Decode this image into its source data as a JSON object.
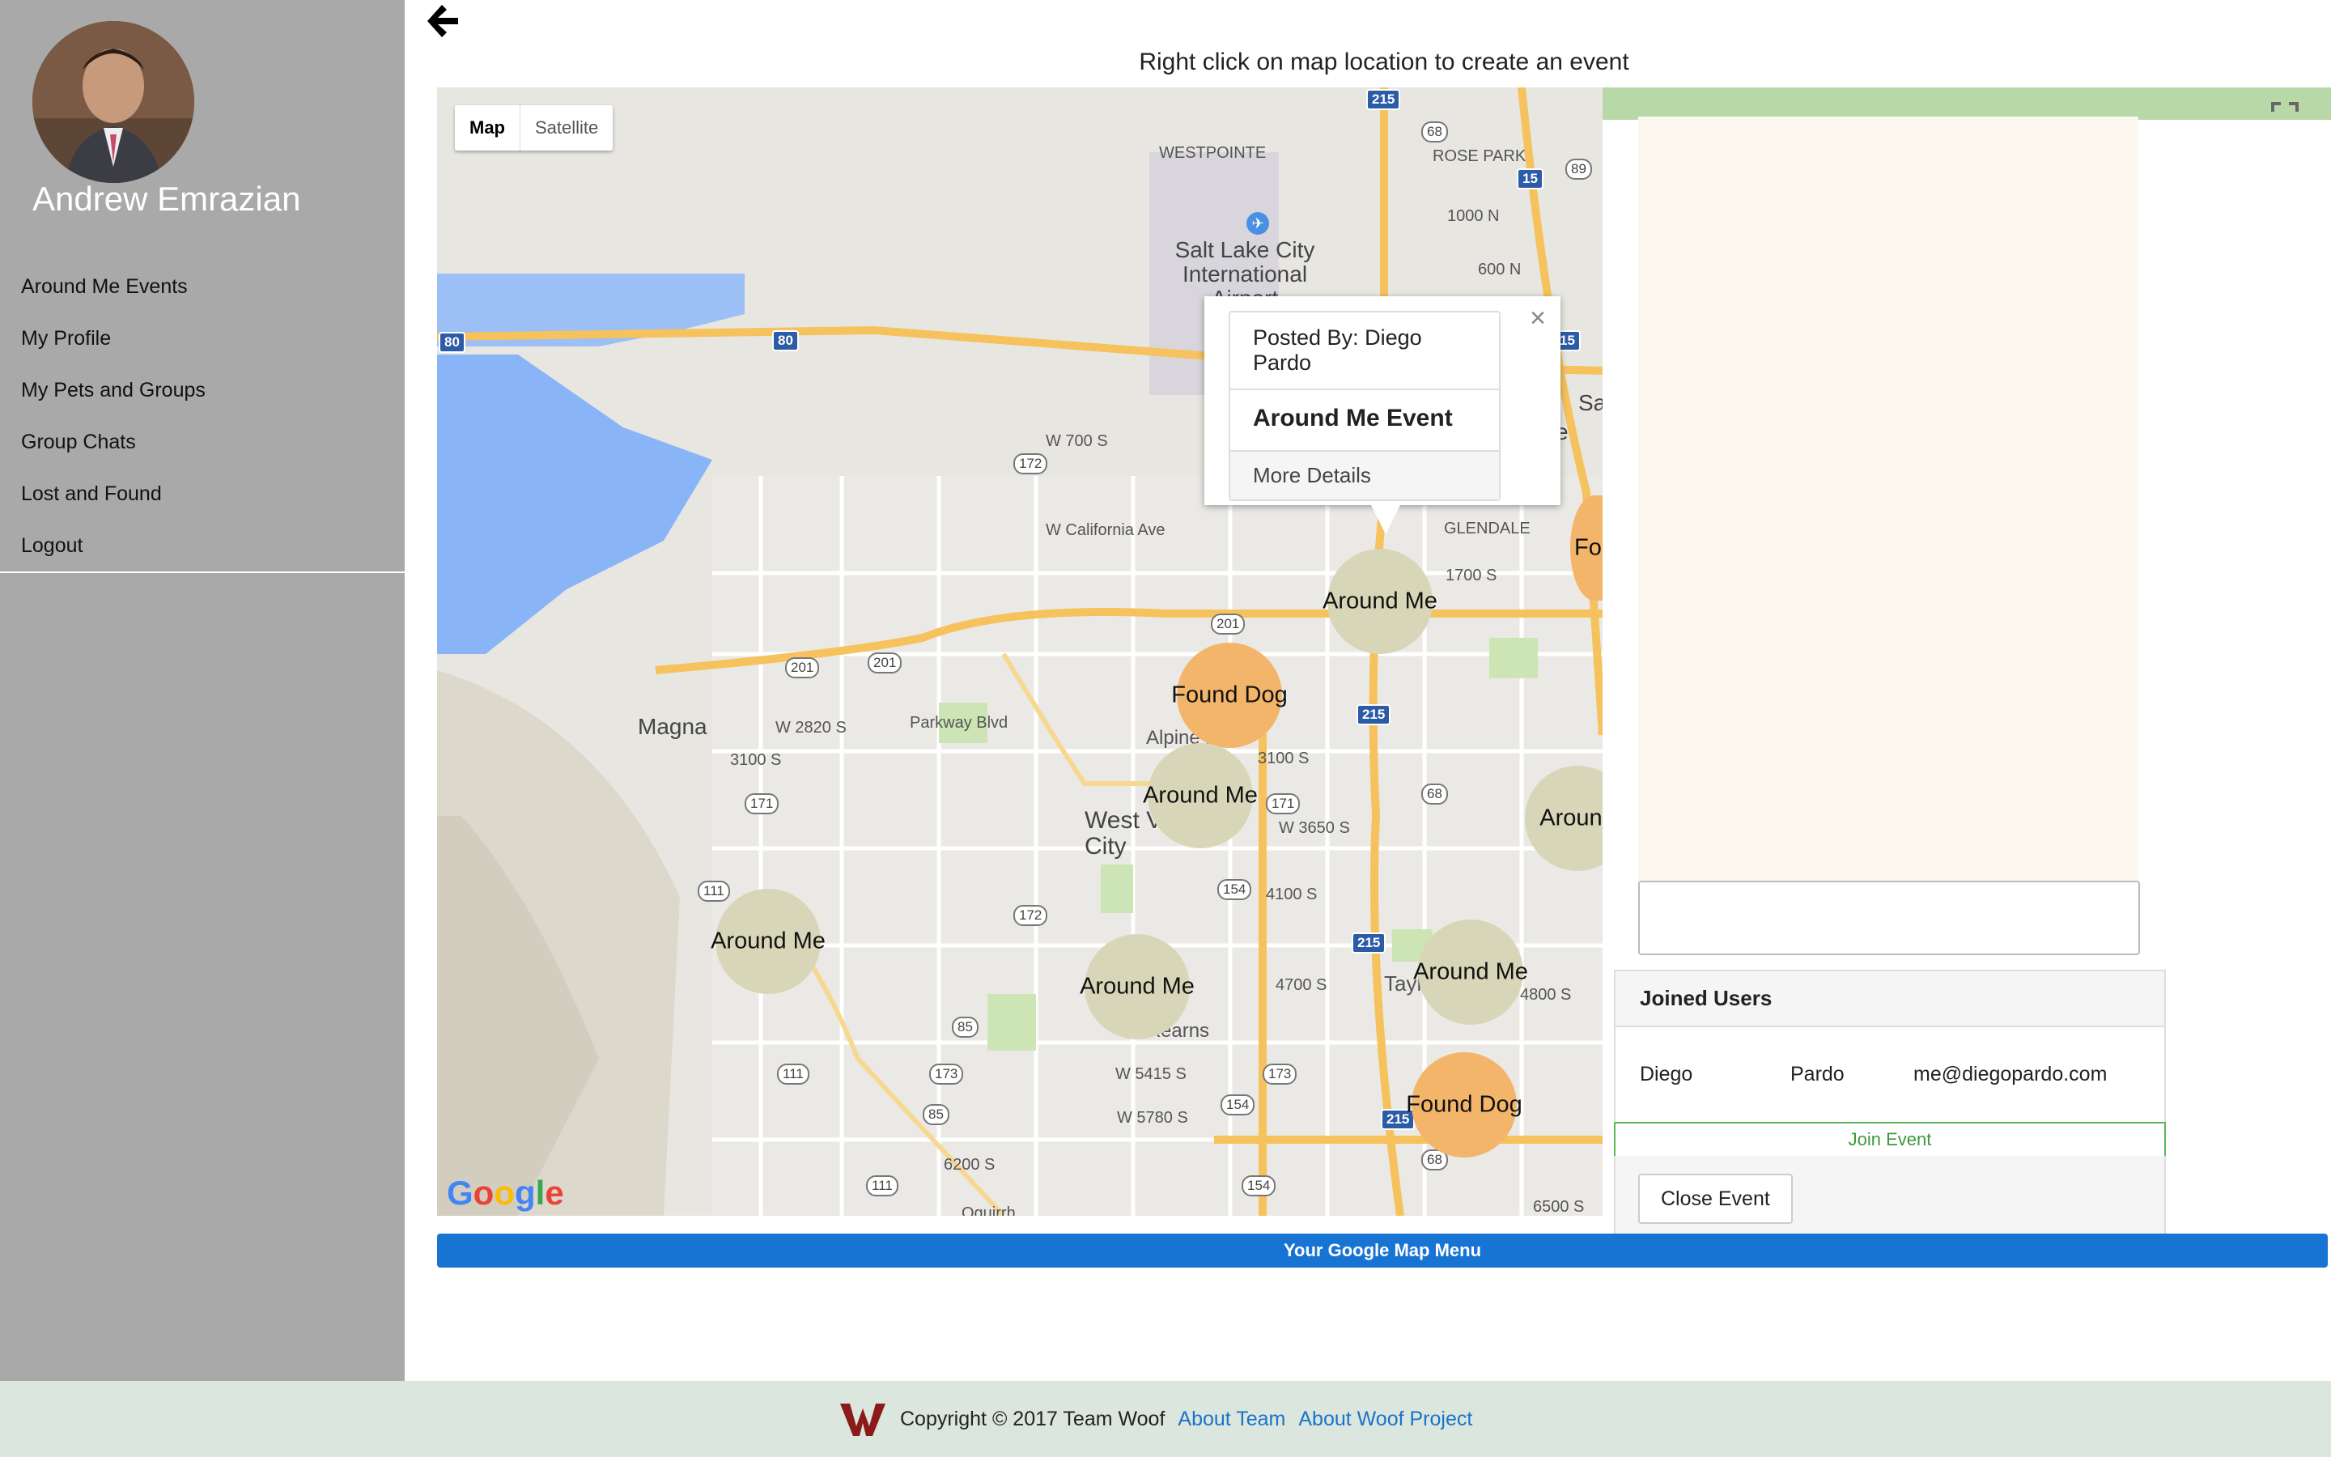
{
  "sidebar": {
    "user_name": "Andrew Emrazian",
    "items": [
      {
        "label": "Around Me Events"
      },
      {
        "label": "My Profile"
      },
      {
        "label": "My Pets and Groups"
      },
      {
        "label": "Group Chats"
      },
      {
        "label": "Lost and Found"
      },
      {
        "label": "Logout"
      }
    ]
  },
  "header": {
    "back_icon": "arrow-left-icon",
    "instructions": "Right click on map location to create an event"
  },
  "map": {
    "type_control": {
      "map": "Map",
      "satellite": "Satellite",
      "selected": "Map"
    },
    "labels": {
      "westpointe": "WESTPOINTE",
      "rose_park": "ROSE PARK",
      "airport": "Salt Lake City International Airport",
      "magna": "Magna",
      "west_valley": "West Valley City",
      "alpine_meadows": "Alpine Mea",
      "glendale": "GLENDALE",
      "kearns": "Kearns",
      "taylorsville": "Tayl",
      "parkway": "Parkway Blvd",
      "california": "W California Ave",
      "w700s": "W 700 S",
      "w2820s": "W 2820 S",
      "oquirrh": "Oquirrh",
      "s1000n": "1000 N",
      "s600n": "600 N",
      "s1700s": "1700 S",
      "s3100s_a": "3100 S",
      "s3100s_b": "3100 S",
      "w3650s": "W 3650 S",
      "s4100s": "4100 S",
      "s4700s": "4700 S",
      "w5415s": "W 5415 S",
      "w5780s": "W 5780 S",
      "s6200s": "6200 S",
      "s6500s": "6500 S",
      "s4800s": "4800 S",
      "sa": "Sa",
      "e": "e"
    },
    "shields": {
      "i215_top": "215",
      "i215_mid": "215",
      "i215_lower": "215",
      "i215_bottom": "215",
      "i80_left": "80",
      "i80_mid": "80",
      "i15": "15",
      "i15b": "15",
      "r201_a": "201",
      "r201_b": "201",
      "r201_c": "201",
      "r172": "172",
      "r172b": "172",
      "r171": "171",
      "r171b": "171",
      "r111": "111",
      "r111b": "111",
      "r111c": "111",
      "r68": "68",
      "r68b": "68",
      "r68c": "68",
      "r154": "154",
      "r154b": "154",
      "r154c": "154",
      "r173": "173",
      "r173b": "173",
      "r85": "85",
      "r85b": "85",
      "r89": "89"
    },
    "markers": [
      {
        "kind": "around",
        "label": "Around Me"
      },
      {
        "kind": "found",
        "label": "Found Dog"
      },
      {
        "kind": "around",
        "label": "Around Me"
      },
      {
        "kind": "around",
        "label": "Around Me"
      },
      {
        "kind": "around",
        "label": "Around Me"
      },
      {
        "kind": "around",
        "label": "Around Me"
      },
      {
        "kind": "found",
        "label": "Found Dog"
      },
      {
        "kind": "around",
        "label": "Around"
      },
      {
        "kind": "found",
        "label": "Fou"
      }
    ],
    "info_window": {
      "posted_by": "Posted By: Diego Pardo",
      "title": "Around Me Event",
      "details_link": "More Details"
    },
    "google_logo": "Google"
  },
  "event_panel": {
    "message_placeholder": "",
    "joined_header": "Joined Users",
    "joined_users": [
      {
        "first": "Diego",
        "last": "Pardo",
        "email": "me@diegopardo.com"
      }
    ],
    "join_button": "Join Event",
    "close_button": "Close Event"
  },
  "menu_bar": {
    "label": "Your Google Map Menu"
  },
  "footer": {
    "copyright": "Copyright © 2017 Team Woof",
    "links": [
      "About Team",
      "About Woof Project"
    ],
    "logo_color": "#8b1a1a"
  },
  "colors": {
    "sidebar_bg": "#a9a9a9",
    "accent_blue": "#1874d2",
    "join_green": "#5cb85c"
  }
}
